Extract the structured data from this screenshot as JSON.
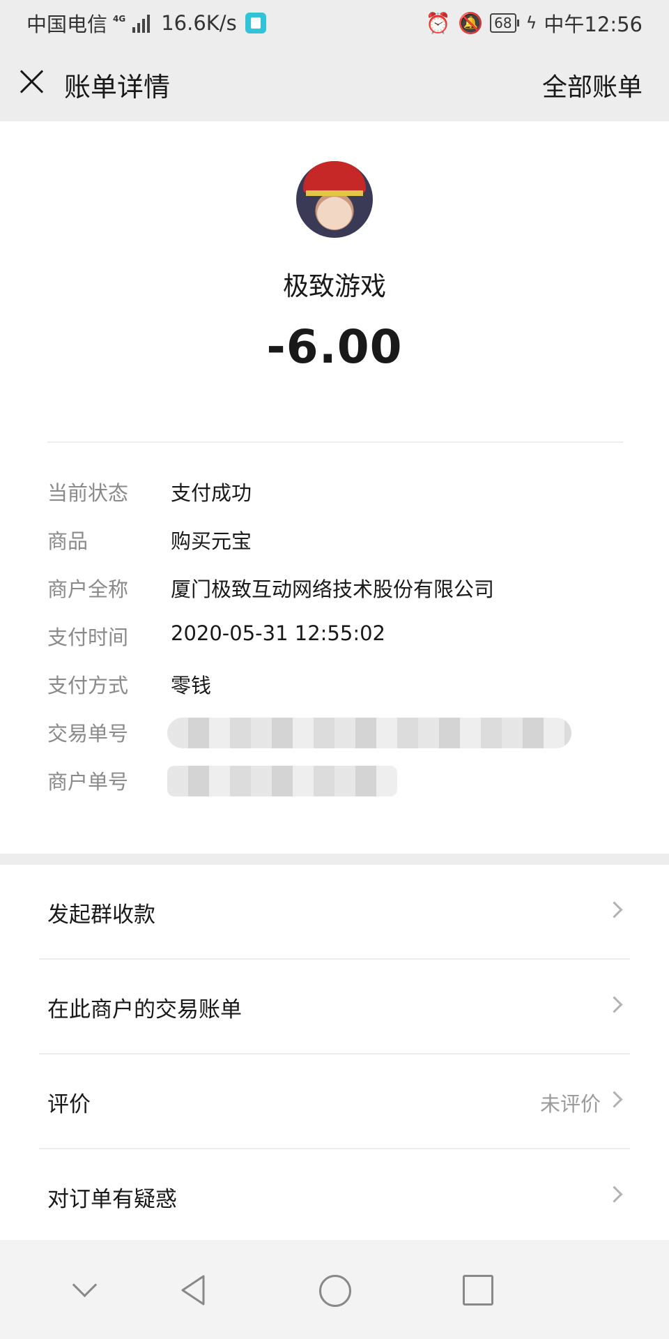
{
  "status_bar": {
    "carrier": "中国电信",
    "network_type": "4G",
    "net_speed": "16.6K/s",
    "battery": "68",
    "time": "中午12:56"
  },
  "nav": {
    "title": "账单详情",
    "right_link": "全部账单"
  },
  "bill": {
    "merchant_display": "极致游戏",
    "amount": "-6.00"
  },
  "details": [
    {
      "label": "当前状态",
      "value": "支付成功"
    },
    {
      "label": "商品",
      "value": "购买元宝"
    },
    {
      "label": "商户全称",
      "value": "厦门极致互动网络技术股份有限公司"
    },
    {
      "label": "支付时间",
      "value": "2020-05-31 12:55:02"
    },
    {
      "label": "支付方式",
      "value": "零钱"
    },
    {
      "label": "交易单号",
      "value": ""
    },
    {
      "label": "商户单号",
      "value": ""
    }
  ],
  "menu": [
    {
      "label": "发起群收款",
      "extra": ""
    },
    {
      "label": "在此商户的交易账单",
      "extra": ""
    },
    {
      "label": "评价",
      "extra": "未评价"
    },
    {
      "label": "对订单有疑惑",
      "extra": ""
    }
  ],
  "colors": {
    "background": "#ededed",
    "card": "#ffffff",
    "label_gray": "#8a8a8a",
    "text": "#191919"
  }
}
